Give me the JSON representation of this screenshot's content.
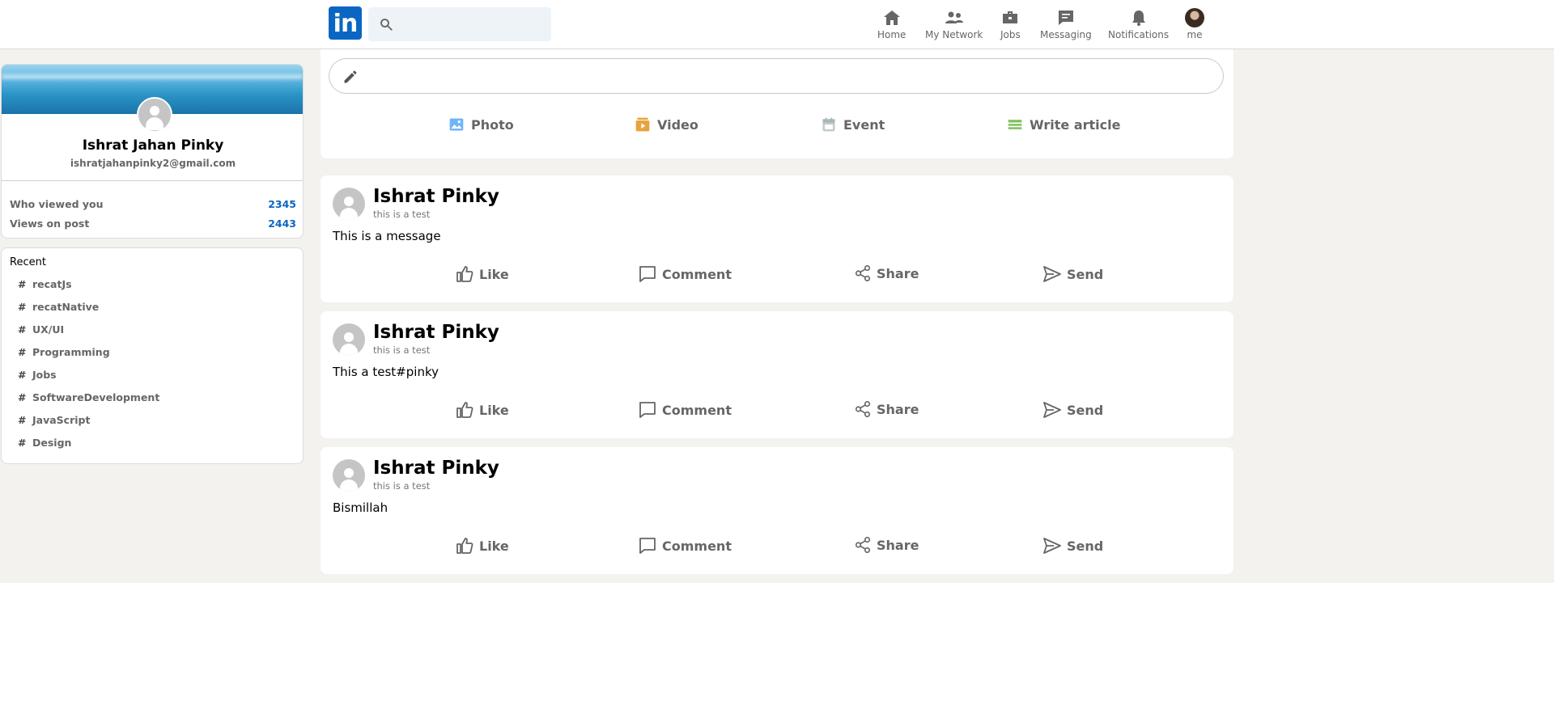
{
  "header": {
    "logo": "in",
    "search": {
      "placeholder": ""
    },
    "nav": [
      {
        "label": "Home",
        "icon": "home-icon"
      },
      {
        "label": "My Network",
        "icon": "network-icon"
      },
      {
        "label": "Jobs",
        "icon": "briefcase-icon"
      },
      {
        "label": "Messaging",
        "icon": "message-icon"
      },
      {
        "label": "Notifications",
        "icon": "bell-icon"
      },
      {
        "label": "me",
        "icon": "avatar"
      }
    ]
  },
  "sidebar": {
    "name": "Ishrat Jahan Pinky",
    "email": "ishratjahanpinky2@gmail.com",
    "stats": [
      {
        "label": "Who viewed you",
        "value": "2345"
      },
      {
        "label": "Views on post",
        "value": "2443"
      }
    ],
    "recent": {
      "title": "Recent",
      "hash": "#",
      "tags": [
        "recatJs",
        "recatNative",
        "UX/UI",
        "Programming",
        "Jobs",
        "SoftwareDevelopment",
        "JavaScript",
        "Design"
      ]
    }
  },
  "share": {
    "actions": [
      {
        "label": "Photo",
        "icon": "photo-icon",
        "color": "#70b5f9"
      },
      {
        "label": "Video",
        "icon": "video-icon",
        "color": "#e7a33e"
      },
      {
        "label": "Event",
        "icon": "calendar-icon",
        "color": "#c0cbcd"
      },
      {
        "label": "Write article",
        "icon": "article-icon",
        "color": "#7fc15e"
      }
    ]
  },
  "posts": [
    {
      "name": "Ishrat Pinky",
      "subtitle": "this is a test",
      "message": "This is a message"
    },
    {
      "name": "Ishrat Pinky",
      "subtitle": "this is a test",
      "message": "This a test#pinky"
    },
    {
      "name": "Ishrat Pinky",
      "subtitle": "this is a test",
      "message": "Bismillah"
    }
  ],
  "post_actions": {
    "like": "Like",
    "comment": "Comment",
    "share": "Share",
    "send": "Send"
  },
  "colors": {
    "brand": "#0a66c2",
    "background": "#f3f2ef",
    "muted": "#666666"
  }
}
